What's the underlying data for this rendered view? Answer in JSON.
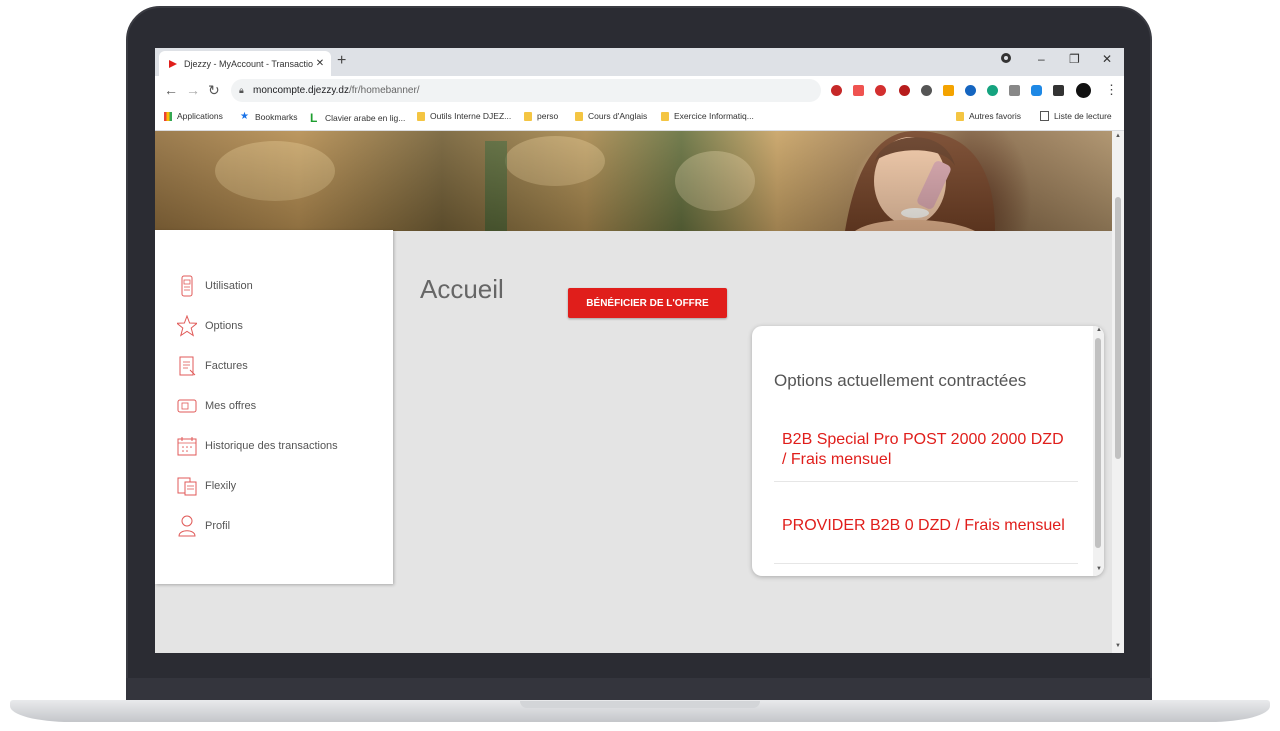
{
  "browser": {
    "tab_title": "Djezzy - MyAccount - Transactio",
    "tab_close": "✕",
    "new_tab": "+",
    "window_controls": [
      "–",
      "❐",
      "✕"
    ],
    "url_domain": "moncompte.djezzy.dz",
    "url_path": "/fr/homebanner/",
    "bookmarks": [
      {
        "label": "Applications",
        "icon": "apps-grid-icon"
      },
      {
        "label": "Bookmarks",
        "icon": "star-icon"
      },
      {
        "label": "Clavier arabe en lig...",
        "icon": "l-logo-icon"
      },
      {
        "label": "Outils Interne DJEZ...",
        "icon": "folder-icon"
      },
      {
        "label": "perso",
        "icon": "folder-icon"
      },
      {
        "label": "Cours d'Anglais",
        "icon": "folder-icon"
      },
      {
        "label": "Exercice Informatiq...",
        "icon": "folder-icon"
      },
      {
        "label": "Autres favoris",
        "icon": "folder-icon"
      },
      {
        "label": "Liste de lecture",
        "icon": "reading-list-icon"
      }
    ]
  },
  "sidebar": {
    "items": [
      {
        "label": "Utilisation",
        "icon": "phone-usage-icon"
      },
      {
        "label": "Options",
        "icon": "star-outline-icon"
      },
      {
        "label": "Factures",
        "icon": "invoice-icon"
      },
      {
        "label": "Mes offres",
        "icon": "offers-icon"
      },
      {
        "label": "Historique des transactions",
        "icon": "calendar-icon"
      },
      {
        "label": "Flexily",
        "icon": "flexily-icon"
      },
      {
        "label": "Profil",
        "icon": "user-icon"
      }
    ]
  },
  "main": {
    "title": "Accueil",
    "offer_button": "BÉNÉFICIER DE L'OFFRE"
  },
  "options_card": {
    "title": "Options actuellement contractées",
    "options": [
      "B2B Special Pro POST 2000 2000 DZD / Frais mensuel",
      "PROVIDER B2B 0 DZD / Frais mensuel"
    ]
  },
  "colors": {
    "accent": "#e01e1b",
    "page_bg": "#e4e4e4",
    "laptop_frame": "#2b2c33"
  }
}
